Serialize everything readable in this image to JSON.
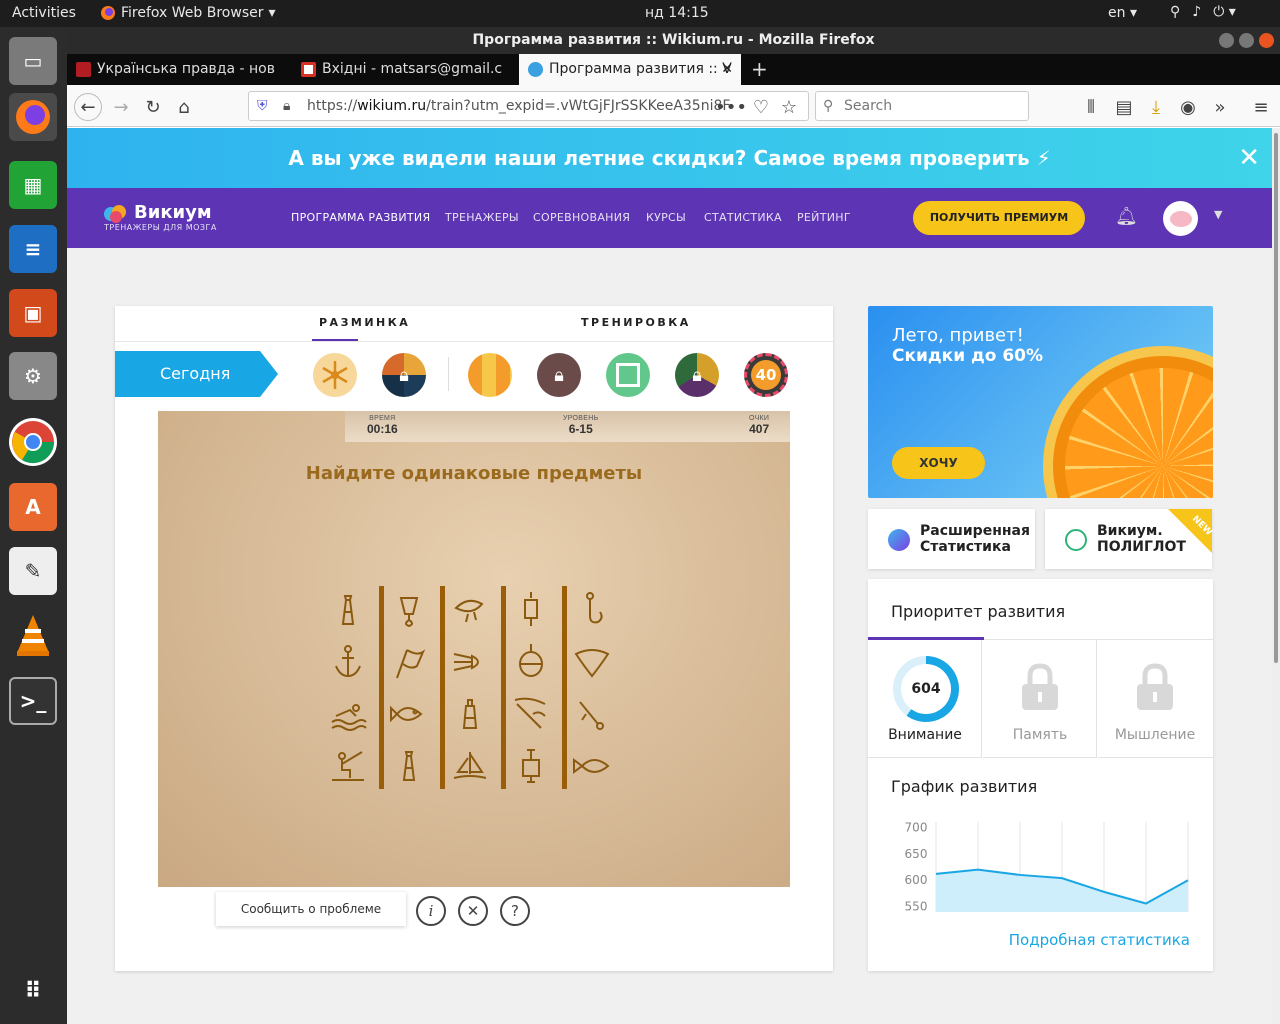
{
  "topbar": {
    "activities": "Activities",
    "app": "Firefox Web Browser",
    "clock": "нд 14:15",
    "lang": "en"
  },
  "window": {
    "title": "Программа развития :: Wikium.ru - Mozilla Firefox"
  },
  "tabs": [
    {
      "label": "Українська правда - нов",
      "color": "#b11d23"
    },
    {
      "label": "Вхідні - matsars@gmail.c",
      "color": "#d93025"
    },
    {
      "label": "Программа развития :: V",
      "color": "#3aa0e0"
    }
  ],
  "navbar": {
    "url_prefix": "https://",
    "url_host": "wikium.ru",
    "url_rest": "/train?utm_expid=.vWtGjFJrSSKKeeA35ni8F",
    "search_placeholder": "Search"
  },
  "promo": {
    "text": "А вы уже видели наши летние скидки? Самое время проверить ⚡"
  },
  "site": {
    "logo": "Викиум",
    "logo_sub": "ТРЕНАЖЕРЫ ДЛЯ МОЗГА",
    "nav": [
      "ПРОГРАММА РАЗВИТИЯ",
      "ТРЕНАЖЕРЫ",
      "СОРЕВНОВАНИЯ",
      "КУРСЫ",
      "СТАТИСТИКА",
      "РЕЙТИНГ"
    ],
    "premium": "ПОЛУЧИТЬ ПРЕМИУМ"
  },
  "game": {
    "tab_warmup": "РАЗМИНКА",
    "tab_training": "ТРЕНИРОВКА",
    "today": "Сегодня",
    "badge": "40",
    "stats": {
      "time_label": "ВРЕМЯ",
      "time": "00:16",
      "level_label": "УРОВЕНЬ",
      "level": "6-15",
      "score_label": "ОЧКИ",
      "score": "407"
    },
    "task": "Найдите одинаковые предметы",
    "report": "Сообщить о проблеме"
  },
  "sale": {
    "line1": "Лето, привет!",
    "line2": "Скидки до 60%",
    "button": "ХОЧУ"
  },
  "mini": {
    "stats": "Расширенная\nСтатистика",
    "polyglot": "Викиум.\nПОЛИГЛОТ",
    "new": "NEW"
  },
  "priority": {
    "title": "Приоритет развития",
    "attention_value": "604",
    "attention": "Внимание",
    "memory": "Память",
    "thinking": "Мышление",
    "graph_title": "График развития",
    "more": "Подробная статистика"
  },
  "chart_data": {
    "type": "area",
    "x": [
      1,
      2,
      3,
      4,
      5,
      6,
      7
    ],
    "values": [
      612,
      620,
      610,
      604,
      578,
      556,
      600
    ],
    "yticks": [
      700,
      650,
      600,
      550
    ],
    "ylim": [
      540,
      710
    ],
    "color": "#19a6e4"
  }
}
